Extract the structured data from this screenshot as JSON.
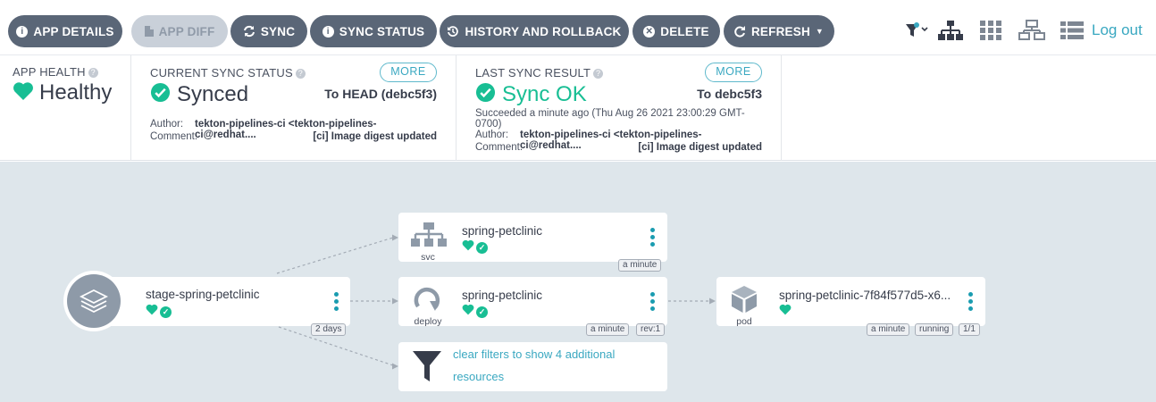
{
  "toolbar": {
    "buttons": [
      {
        "label": "APP DETAILS",
        "icon": "info-circle-icon"
      },
      {
        "label": "APP DIFF",
        "icon": "file-icon"
      },
      {
        "label": "SYNC",
        "icon": "sync-icon"
      },
      {
        "label": "SYNC STATUS",
        "icon": "info-circle-icon"
      },
      {
        "label": "HISTORY AND ROLLBACK",
        "icon": "history-icon"
      },
      {
        "label": "DELETE",
        "icon": "times-circle-icon"
      },
      {
        "label": "REFRESH",
        "icon": "redo-icon"
      }
    ],
    "view_icons": [
      "filter-icon",
      "tree-view-icon",
      "pods-grid-icon",
      "network-view-icon",
      "list-view-icon"
    ],
    "logout_label": "Log out"
  },
  "status": {
    "app_health": {
      "label": "APP HEALTH",
      "value": "Healthy"
    },
    "current_sync": {
      "label": "CURRENT SYNC STATUS",
      "more": "MORE",
      "value": "Synced",
      "target": "To HEAD (debc5f3)",
      "author_label": "Author:",
      "author": "tekton-pipelines-ci <tekton-pipelines-ci@redhat....",
      "comment_label": "Comment:",
      "comment": "[ci] Image digest updated"
    },
    "last_sync": {
      "label": "LAST SYNC RESULT",
      "more": "MORE",
      "value": "Sync OK",
      "target": "To debc5f3",
      "succeeded_line1": "Succeeded a minute ago (Thu Aug 26 2021 23:00:29 GMT-",
      "succeeded_line2": "0700)",
      "author_label": "Author:",
      "author": "tekton-pipelines-ci <tekton-pipelines-ci@redhat....",
      "comment_label": "Comment:",
      "comment": "[ci] Image digest updated"
    }
  },
  "tree": {
    "app": {
      "name": "stage-spring-petclinic",
      "age": "2 days"
    },
    "svc": {
      "name": "spring-petclinic",
      "kind": "svc",
      "age": "a minute"
    },
    "deploy": {
      "name": "spring-petclinic",
      "kind": "deploy",
      "age": "a minute",
      "rev": "rev:1"
    },
    "pod": {
      "name": "spring-petclinic-7f84f577d5-x6...",
      "kind": "pod",
      "age": "a minute",
      "state": "running",
      "ready": "1/1"
    },
    "filter": {
      "line1": "clear filters to show 4 additional",
      "line2": "resources"
    }
  },
  "colors": {
    "accent": "#3aa8c1",
    "healthy": "#18be94",
    "button": "#5a6677",
    "canvas": "#dee6eb"
  }
}
